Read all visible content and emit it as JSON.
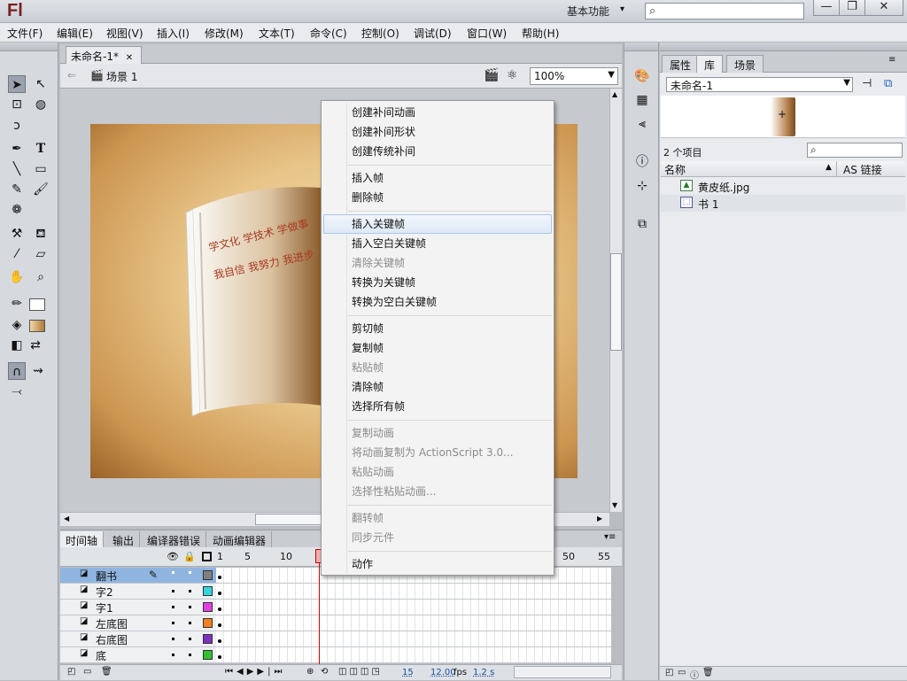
{
  "app": {
    "logo": "Fl",
    "workspace": "基本功能",
    "win_min": "—",
    "win_max": "❐",
    "win_close": "✕"
  },
  "menu": [
    "文件(F)",
    "编辑(E)",
    "视图(V)",
    "插入(I)",
    "修改(M)",
    "文本(T)",
    "命令(C)",
    "控制(O)",
    "调试(D)",
    "窗口(W)",
    "帮助(H)"
  ],
  "document": {
    "tab": "未命名-1*",
    "close": "✕",
    "scene": "场景 1",
    "zoom": "100%"
  },
  "stage": {
    "book_line1": "学文化  学技术  学做事",
    "book_line2": "我自信  我努力  我进步"
  },
  "context_menu": {
    "g1": [
      "创建补间动画",
      "创建补间形状",
      "创建传统补间"
    ],
    "g2": [
      "插入帧",
      "删除帧"
    ],
    "g3": [
      "插入关键帧",
      "插入空白关键帧",
      "清除关键帧",
      "转换为关键帧",
      "转换为空白关键帧"
    ],
    "g4": [
      "剪切帧",
      "复制帧",
      "粘贴帧",
      "清除帧",
      "选择所有帧"
    ],
    "g5": [
      "复制动画",
      "将动画复制为 ActionScript 3.0...",
      "粘贴动画",
      "选择性粘贴动画..."
    ],
    "g6": [
      "翻转帧",
      "同步元件"
    ],
    "g7": [
      "动作"
    ]
  },
  "bottom_tabs": [
    "时间轴",
    "输出",
    "编译器错误",
    "动画编辑器"
  ],
  "timeline": {
    "ruler": [
      "1",
      "5",
      "10",
      "15",
      "50",
      "55"
    ],
    "layers": [
      {
        "name": "翻书",
        "color": "#808080"
      },
      {
        "name": "字2",
        "color": "#33d6e0"
      },
      {
        "name": "字1",
        "color": "#e040e0"
      },
      {
        "name": "左底图",
        "color": "#f08020"
      },
      {
        "name": "右底图",
        "color": "#8030c0"
      },
      {
        "name": "底",
        "color": "#30c030"
      }
    ],
    "current_frame": "15",
    "fps": "12.00",
    "fps_unit": "fps",
    "time": "1.2 s"
  },
  "library": {
    "tabs": [
      "属性",
      "库",
      "场景"
    ],
    "document": "未命名-1",
    "count": "2 个项目",
    "col_name": "名称",
    "col_link": "AS 链接",
    "items": [
      "黄皮纸.jpg",
      "书 1"
    ]
  }
}
